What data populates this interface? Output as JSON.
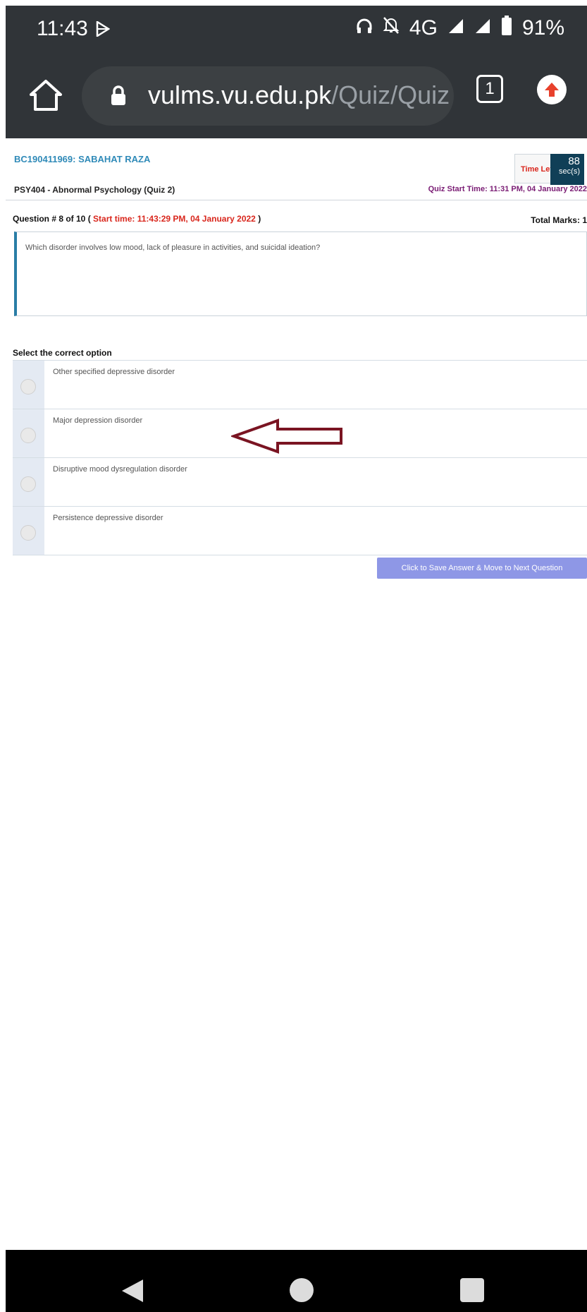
{
  "status_bar": {
    "time": "11:43",
    "network": "4G",
    "battery": "91%"
  },
  "browser": {
    "url_host": "vulms.vu.edu.pk",
    "url_path": "/Quiz/Quiz",
    "tab_count": "1"
  },
  "quiz": {
    "student": "BC190411969: SABAHAT RAZA",
    "course": "PSY404 - Abnormal Psychology (Quiz 2)",
    "time_left_label": "Time Left",
    "time_left_value": "88",
    "time_left_unit": "sec(s)",
    "quiz_start": "Quiz Start Time: 11:31 PM, 04 January 2022",
    "question_prefix": "Question # 8 of 10 (",
    "question_start": "Start time: 11:43:29 PM, 04 January 2022",
    "question_suffix": ")",
    "total_marks": "Total Marks: 1",
    "question_text": "Which disorder involves low mood, lack of pleasure in activities, and suicidal ideation?",
    "select_label": "Select the correct option",
    "options": [
      "Other specified depressive disorder",
      "Major depression disorder",
      "Disruptive mood dysregulation disorder",
      "Persistence depressive disorder"
    ],
    "next_button": "Click to Save Answer & Move to Next Question"
  },
  "colors": {
    "arrow": "#7a1422",
    "timer_bg": "#103f57",
    "next_button_bg": "#8e97e6"
  }
}
